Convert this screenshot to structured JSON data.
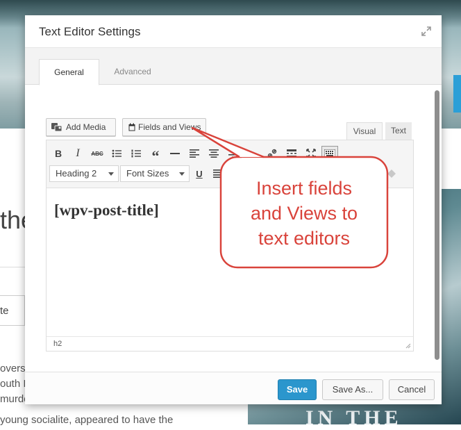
{
  "background": {
    "heading_fragment": "the",
    "input_fragment": "te",
    "text_lines": [
      "overs",
      "outh I",
      "murde",
      "young socialite, appeared to have the"
    ],
    "book_title_fragment": "IN THE"
  },
  "modal": {
    "title": "Text Editor Settings",
    "tabs": [
      {
        "label": "General",
        "active": true
      },
      {
        "label": "Advanced",
        "active": false
      }
    ],
    "buttons": {
      "add_media": "Add Media",
      "fields_and_views": "Fields and Views"
    },
    "editor_tabs": {
      "visual": "Visual",
      "text": "Text"
    },
    "toolbar": {
      "row1_icons": [
        "bold-icon",
        "italic-icon",
        "strikethrough-icon",
        "bullet-list-icon",
        "numbered-list-icon",
        "blockquote-icon",
        "horizontal-rule-icon",
        "align-left-icon",
        "align-center-icon",
        "align-right-icon",
        "link-icon",
        "unlink-icon",
        "read-more-icon",
        "fullscreen-icon",
        "toolbar-toggle-icon"
      ],
      "format_select": "Heading 2",
      "font_size_select": "Font Sizes",
      "row2_icons": [
        "underline-icon",
        "justify-icon"
      ]
    },
    "content": "[wpv-post-title]",
    "status_path": "h2",
    "footer": {
      "save": "Save",
      "save_as": "Save As...",
      "cancel": "Cancel"
    }
  },
  "callout": {
    "lines": [
      "Insert fields",
      "and Views to",
      "text editors"
    ],
    "color": "#d9433b"
  },
  "colors": {
    "primary_button": "#2b96cd",
    "accent_blue": "#2b9fd7"
  }
}
